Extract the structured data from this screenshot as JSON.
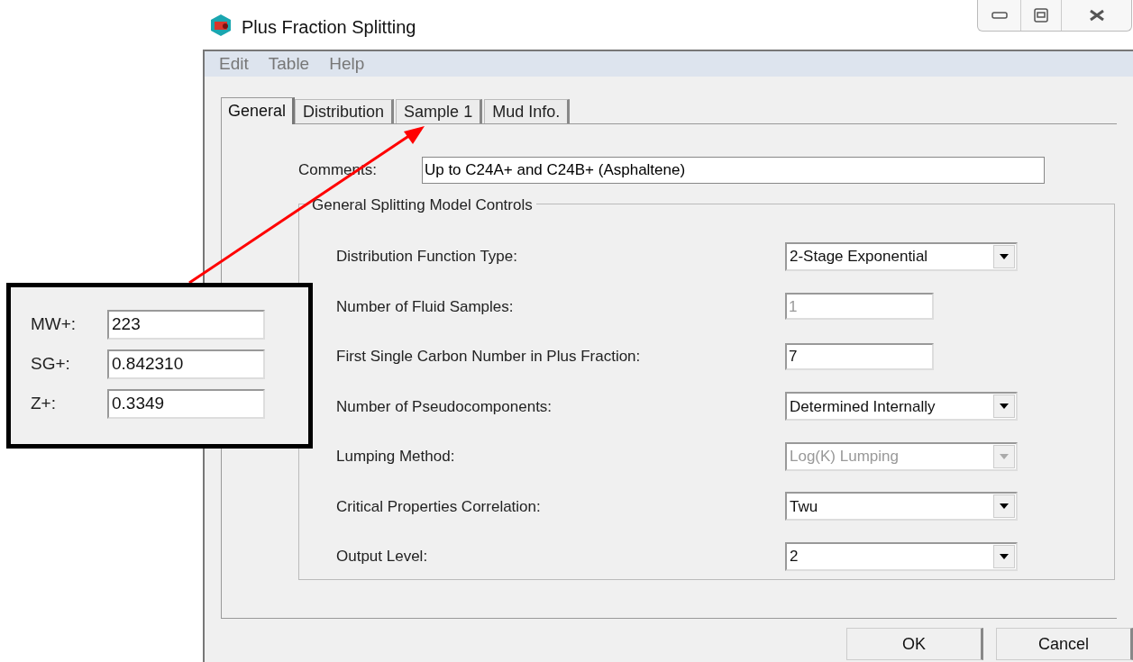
{
  "window": {
    "title": "Plus Fraction Splitting"
  },
  "menu": [
    "Edit",
    "Table",
    "Help"
  ],
  "tabs": [
    {
      "label": "General",
      "selected": true
    },
    {
      "label": "Distribution",
      "selected": false
    },
    {
      "label": "Sample 1",
      "selected": false
    },
    {
      "label": "Mud Info.",
      "selected": false
    }
  ],
  "comments": {
    "label": "Comments:",
    "value": "Up to C24A+ and C24B+ (Asphaltene)"
  },
  "group": {
    "title": "General Splitting Model Controls",
    "rows": [
      {
        "label": "Distribution Function Type:",
        "kind": "combo",
        "value": "2-Stage Exponential",
        "disabled": false
      },
      {
        "label": "Number of Fluid Samples:",
        "kind": "text",
        "value": "1",
        "disabled": true
      },
      {
        "label": "First Single Carbon Number in Plus Fraction:",
        "kind": "text",
        "value": "7",
        "disabled": false
      },
      {
        "label": "Number of Pseudocomponents:",
        "kind": "combo",
        "value": "Determined Internally",
        "disabled": false
      },
      {
        "label": "Lumping Method:",
        "kind": "combo",
        "value": "Log(K) Lumping",
        "disabled": true
      },
      {
        "label": "Critical Properties Correlation:",
        "kind": "combo",
        "value": "Twu",
        "disabled": false
      },
      {
        "label": "Output Level:",
        "kind": "combo",
        "value": "2",
        "disabled": false
      }
    ]
  },
  "buttons": [
    "OK",
    "Cancel"
  ],
  "callout": {
    "fields": [
      {
        "label": "MW+:",
        "value": "223"
      },
      {
        "label": "SG+:",
        "value": "0.842310"
      },
      {
        "label": "Z+:",
        "value": "0.3349"
      }
    ]
  }
}
